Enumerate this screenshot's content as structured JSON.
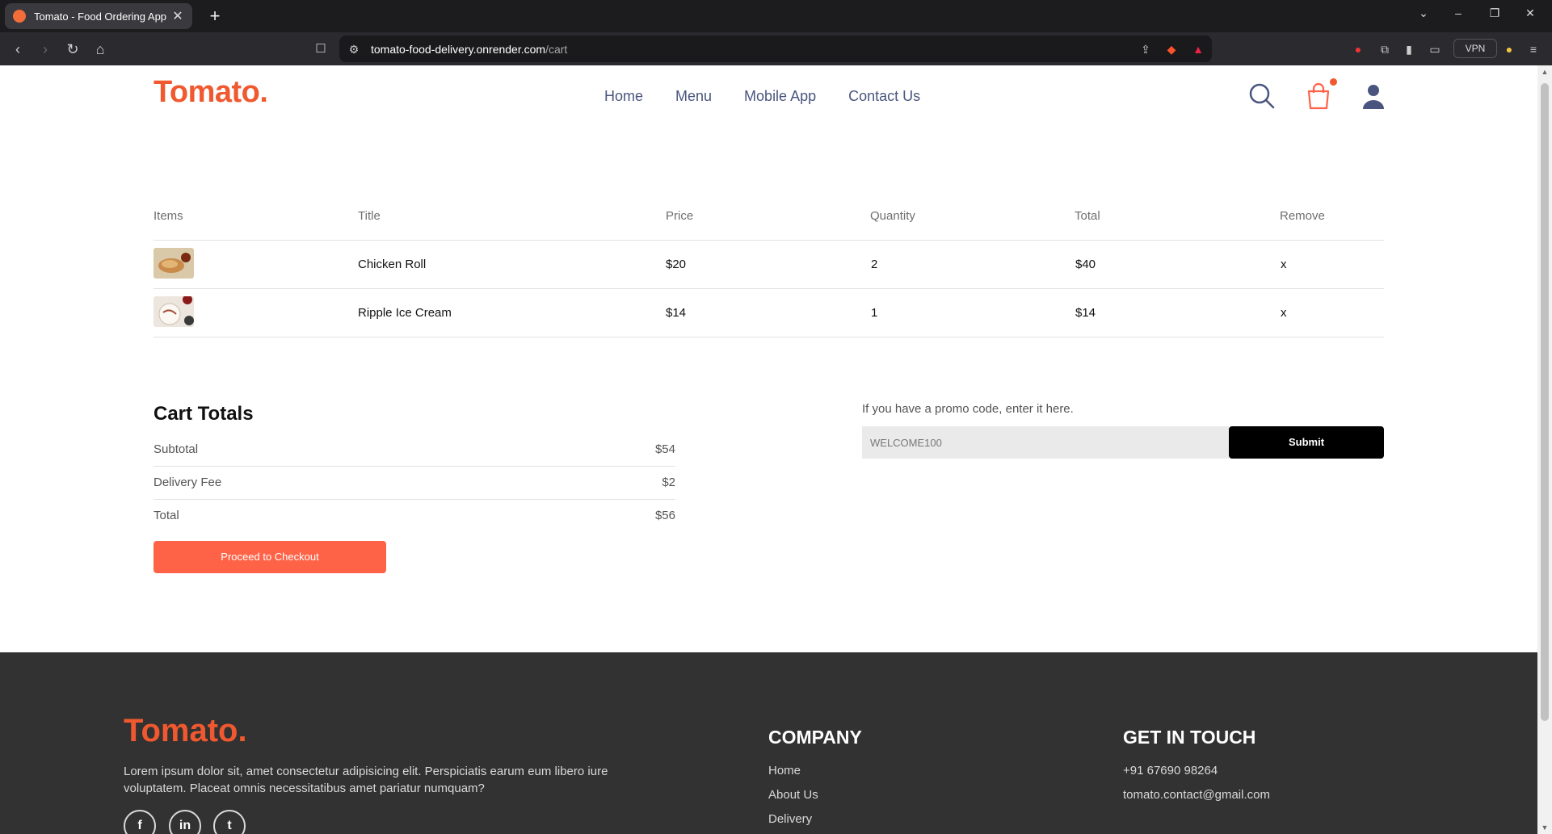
{
  "browser": {
    "tab_title": "Tomato - Food Ordering App",
    "url_domain": "tomato-food-delivery.onrender.com",
    "url_path": "/cart",
    "vpn_label": "VPN"
  },
  "header": {
    "logo": "Tomato.",
    "nav": [
      "Home",
      "Menu",
      "Mobile App",
      "Contact Us"
    ]
  },
  "cart": {
    "columns": [
      "Items",
      "Title",
      "Price",
      "Quantity",
      "Total",
      "Remove"
    ],
    "rows": [
      {
        "title": "Chicken Roll",
        "price": "$20",
        "quantity": "2",
        "total": "$40",
        "remove": "x"
      },
      {
        "title": "Ripple Ice Cream",
        "price": "$14",
        "quantity": "1",
        "total": "$14",
        "remove": "x"
      }
    ]
  },
  "totals": {
    "title": "Cart Totals",
    "subtotal_label": "Subtotal",
    "subtotal": "$54",
    "delivery_label": "Delivery Fee",
    "delivery": "$2",
    "total_label": "Total",
    "total": "$56",
    "checkout_label": "Proceed to Checkout"
  },
  "promo": {
    "label": "If you have a promo code, enter it here.",
    "value": "WELCOME100",
    "submit_label": "Submit"
  },
  "footer": {
    "logo": "Tomato.",
    "description": "Lorem ipsum dolor sit, amet consectetur adipisicing elit. Perspiciatis earum eum libero iure voluptatem. Placeat omnis necessitatibus amet pariatur numquam?",
    "company_title": "COMPANY",
    "company_links": [
      "Home",
      "About Us",
      "Delivery"
    ],
    "contact_title": "GET IN TOUCH",
    "phone": "+91 67690 98264",
    "email": "tomato.contact@gmail.com",
    "social_icons": [
      "facebook-icon",
      "linkedin-icon",
      "twitter-icon"
    ]
  },
  "colors": {
    "brand": "#f0592f",
    "checkout": "#ff6347",
    "nav_text": "#49557e",
    "footer_bg": "#323232"
  }
}
